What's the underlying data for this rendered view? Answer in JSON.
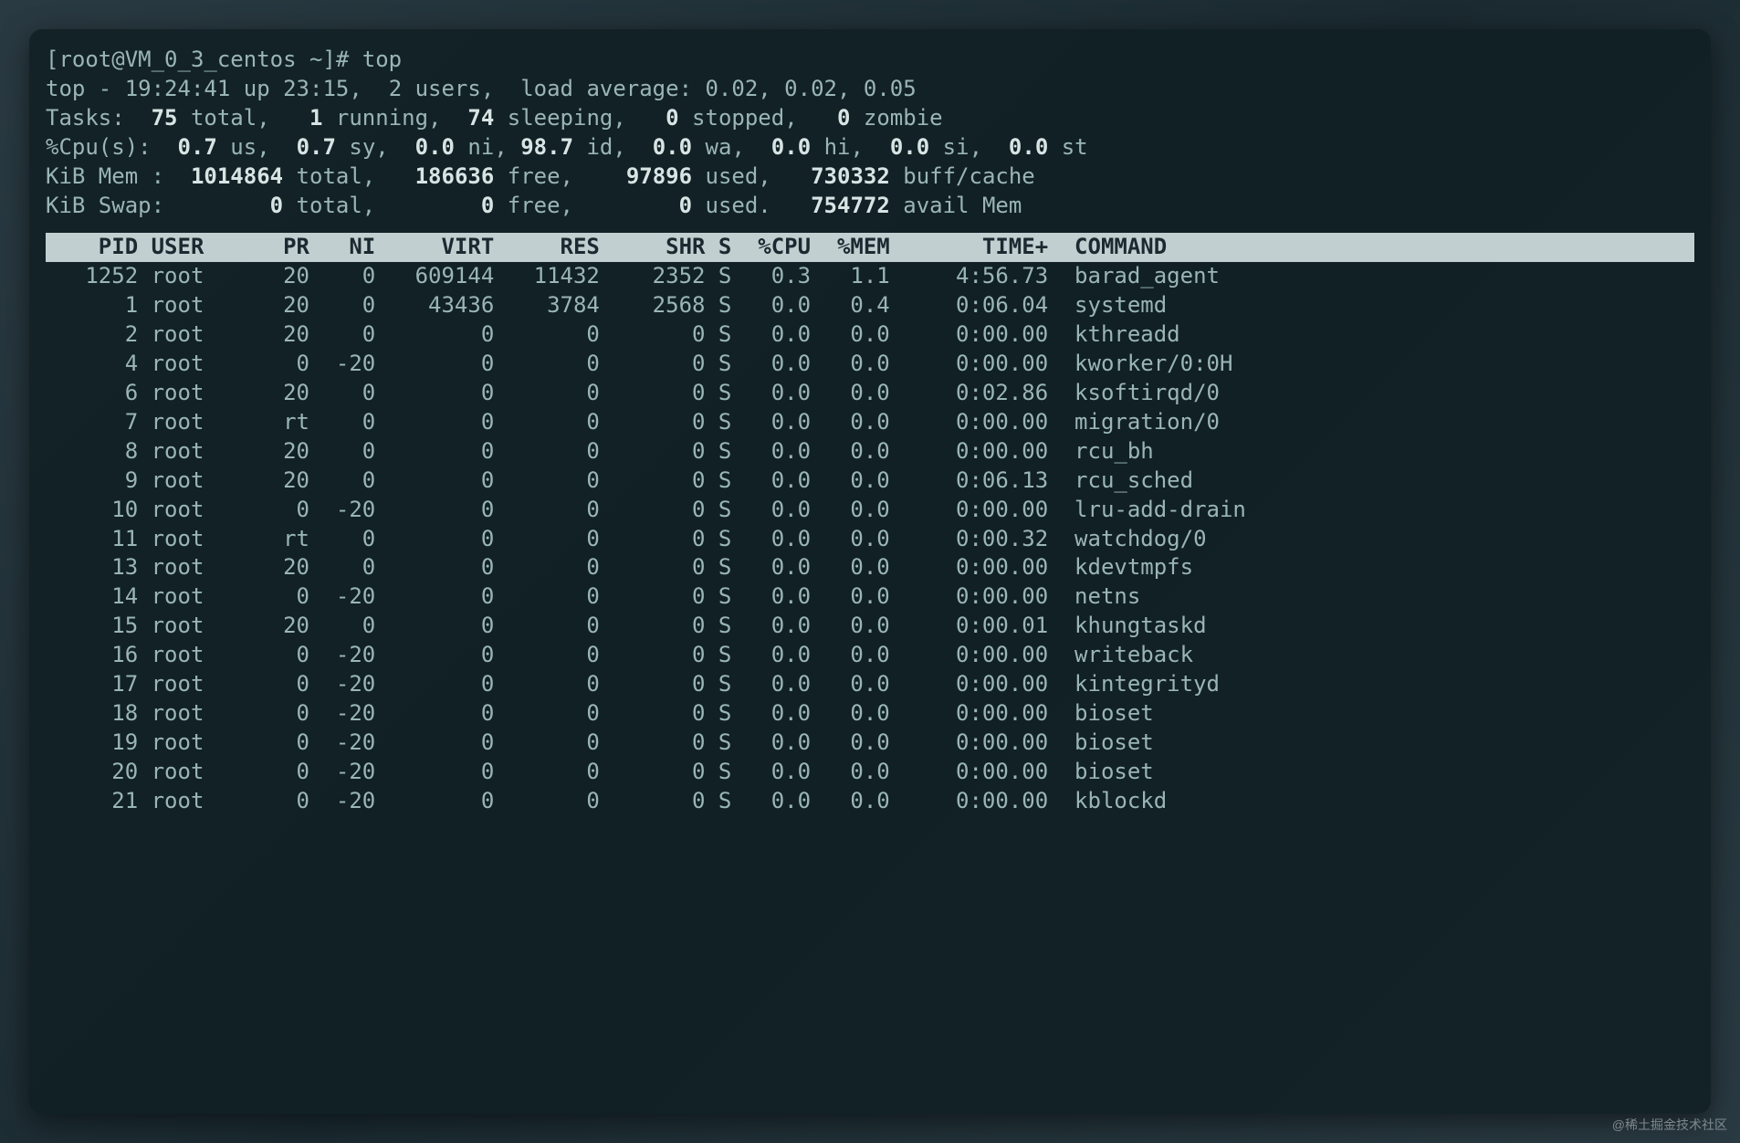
{
  "prompt": "[root@VM_0_3_centos ~]# top",
  "summary": {
    "line1_prefix": "top - ",
    "time": "19:24:41",
    "uptime": " up 23:15,  ",
    "users": "2 users",
    "load_label": ",  load average: ",
    "load": "0.02, 0.02, 0.05",
    "tasks_label": "Tasks:  ",
    "tasks_total": "75",
    "tasks_total_lbl": " total,   ",
    "tasks_running": "1",
    "tasks_running_lbl": " running,  ",
    "tasks_sleeping": "74",
    "tasks_sleeping_lbl": " sleeping,   ",
    "tasks_stopped": "0",
    "tasks_stopped_lbl": " stopped,   ",
    "tasks_zombie": "0",
    "tasks_zombie_lbl": " zombie",
    "cpu_label": "%Cpu(s):  ",
    "cpu_us": "0.7",
    "cpu_us_lbl": " us,  ",
    "cpu_sy": "0.7",
    "cpu_sy_lbl": " sy,  ",
    "cpu_ni": "0.0",
    "cpu_ni_lbl": " ni, ",
    "cpu_id": "98.7",
    "cpu_id_lbl": " id,  ",
    "cpu_wa": "0.0",
    "cpu_wa_lbl": " wa,  ",
    "cpu_hi": "0.0",
    "cpu_hi_lbl": " hi,  ",
    "cpu_si": "0.0",
    "cpu_si_lbl": " si,  ",
    "cpu_st": "0.0",
    "cpu_st_lbl": " st",
    "mem_label": "KiB Mem :  ",
    "mem_total": "1014864",
    "mem_total_lbl": " total,   ",
    "mem_free": "186636",
    "mem_free_lbl": " free,    ",
    "mem_used": "97896",
    "mem_used_lbl": " used,   ",
    "mem_buff": "730332",
    "mem_buff_lbl": " buff/cache",
    "swap_label": "KiB Swap:        ",
    "swap_total": "0",
    "swap_total_lbl": " total,        ",
    "swap_free": "0",
    "swap_free_lbl": " free,        ",
    "swap_used": "0",
    "swap_used_lbl": " used.   ",
    "swap_avail": "754772",
    "swap_avail_lbl": " avail Mem"
  },
  "columns": [
    "PID",
    "USER",
    "PR",
    "NI",
    "VIRT",
    "RES",
    "SHR",
    "S",
    "%CPU",
    "%MEM",
    "TIME+",
    "COMMAND"
  ],
  "rows": [
    {
      "pid": "1252",
      "user": "root",
      "pr": "20",
      "ni": "0",
      "virt": "609144",
      "res": "11432",
      "shr": "2352",
      "s": "S",
      "cpu": "0.3",
      "mem": "1.1",
      "time": "4:56.73",
      "cmd": "barad_agent"
    },
    {
      "pid": "1",
      "user": "root",
      "pr": "20",
      "ni": "0",
      "virt": "43436",
      "res": "3784",
      "shr": "2568",
      "s": "S",
      "cpu": "0.0",
      "mem": "0.4",
      "time": "0:06.04",
      "cmd": "systemd"
    },
    {
      "pid": "2",
      "user": "root",
      "pr": "20",
      "ni": "0",
      "virt": "0",
      "res": "0",
      "shr": "0",
      "s": "S",
      "cpu": "0.0",
      "mem": "0.0",
      "time": "0:00.00",
      "cmd": "kthreadd"
    },
    {
      "pid": "4",
      "user": "root",
      "pr": "0",
      "ni": "-20",
      "virt": "0",
      "res": "0",
      "shr": "0",
      "s": "S",
      "cpu": "0.0",
      "mem": "0.0",
      "time": "0:00.00",
      "cmd": "kworker/0:0H"
    },
    {
      "pid": "6",
      "user": "root",
      "pr": "20",
      "ni": "0",
      "virt": "0",
      "res": "0",
      "shr": "0",
      "s": "S",
      "cpu": "0.0",
      "mem": "0.0",
      "time": "0:02.86",
      "cmd": "ksoftirqd/0"
    },
    {
      "pid": "7",
      "user": "root",
      "pr": "rt",
      "ni": "0",
      "virt": "0",
      "res": "0",
      "shr": "0",
      "s": "S",
      "cpu": "0.0",
      "mem": "0.0",
      "time": "0:00.00",
      "cmd": "migration/0"
    },
    {
      "pid": "8",
      "user": "root",
      "pr": "20",
      "ni": "0",
      "virt": "0",
      "res": "0",
      "shr": "0",
      "s": "S",
      "cpu": "0.0",
      "mem": "0.0",
      "time": "0:00.00",
      "cmd": "rcu_bh"
    },
    {
      "pid": "9",
      "user": "root",
      "pr": "20",
      "ni": "0",
      "virt": "0",
      "res": "0",
      "shr": "0",
      "s": "S",
      "cpu": "0.0",
      "mem": "0.0",
      "time": "0:06.13",
      "cmd": "rcu_sched"
    },
    {
      "pid": "10",
      "user": "root",
      "pr": "0",
      "ni": "-20",
      "virt": "0",
      "res": "0",
      "shr": "0",
      "s": "S",
      "cpu": "0.0",
      "mem": "0.0",
      "time": "0:00.00",
      "cmd": "lru-add-drain"
    },
    {
      "pid": "11",
      "user": "root",
      "pr": "rt",
      "ni": "0",
      "virt": "0",
      "res": "0",
      "shr": "0",
      "s": "S",
      "cpu": "0.0",
      "mem": "0.0",
      "time": "0:00.32",
      "cmd": "watchdog/0"
    },
    {
      "pid": "13",
      "user": "root",
      "pr": "20",
      "ni": "0",
      "virt": "0",
      "res": "0",
      "shr": "0",
      "s": "S",
      "cpu": "0.0",
      "mem": "0.0",
      "time": "0:00.00",
      "cmd": "kdevtmpfs"
    },
    {
      "pid": "14",
      "user": "root",
      "pr": "0",
      "ni": "-20",
      "virt": "0",
      "res": "0",
      "shr": "0",
      "s": "S",
      "cpu": "0.0",
      "mem": "0.0",
      "time": "0:00.00",
      "cmd": "netns"
    },
    {
      "pid": "15",
      "user": "root",
      "pr": "20",
      "ni": "0",
      "virt": "0",
      "res": "0",
      "shr": "0",
      "s": "S",
      "cpu": "0.0",
      "mem": "0.0",
      "time": "0:00.01",
      "cmd": "khungtaskd"
    },
    {
      "pid": "16",
      "user": "root",
      "pr": "0",
      "ni": "-20",
      "virt": "0",
      "res": "0",
      "shr": "0",
      "s": "S",
      "cpu": "0.0",
      "mem": "0.0",
      "time": "0:00.00",
      "cmd": "writeback"
    },
    {
      "pid": "17",
      "user": "root",
      "pr": "0",
      "ni": "-20",
      "virt": "0",
      "res": "0",
      "shr": "0",
      "s": "S",
      "cpu": "0.0",
      "mem": "0.0",
      "time": "0:00.00",
      "cmd": "kintegrityd"
    },
    {
      "pid": "18",
      "user": "root",
      "pr": "0",
      "ni": "-20",
      "virt": "0",
      "res": "0",
      "shr": "0",
      "s": "S",
      "cpu": "0.0",
      "mem": "0.0",
      "time": "0:00.00",
      "cmd": "bioset"
    },
    {
      "pid": "19",
      "user": "root",
      "pr": "0",
      "ni": "-20",
      "virt": "0",
      "res": "0",
      "shr": "0",
      "s": "S",
      "cpu": "0.0",
      "mem": "0.0",
      "time": "0:00.00",
      "cmd": "bioset"
    },
    {
      "pid": "20",
      "user": "root",
      "pr": "0",
      "ni": "-20",
      "virt": "0",
      "res": "0",
      "shr": "0",
      "s": "S",
      "cpu": "0.0",
      "mem": "0.0",
      "time": "0:00.00",
      "cmd": "bioset"
    },
    {
      "pid": "21",
      "user": "root",
      "pr": "0",
      "ni": "-20",
      "virt": "0",
      "res": "0",
      "shr": "0",
      "s": "S",
      "cpu": "0.0",
      "mem": "0.0",
      "time": "0:00.00",
      "cmd": "kblockd"
    }
  ],
  "watermark": "@稀土掘金技术社区"
}
